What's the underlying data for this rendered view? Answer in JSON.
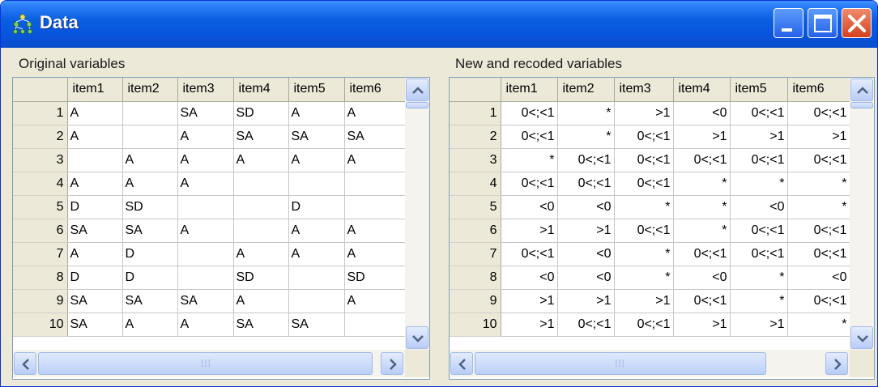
{
  "window": {
    "title": "Data",
    "buttons": [
      "minimize",
      "maximize",
      "close"
    ]
  },
  "left": {
    "label": "Original variables",
    "columns": [
      "item1",
      "item2",
      "item3",
      "item4",
      "item5",
      "item6"
    ],
    "rows": [
      {
        "n": "1",
        "cells": [
          "A",
          "",
          "SA",
          "SD",
          "A",
          "A"
        ]
      },
      {
        "n": "2",
        "cells": [
          "A",
          "",
          "A",
          "SA",
          "SA",
          "SA"
        ]
      },
      {
        "n": "3",
        "cells": [
          "",
          "A",
          "A",
          "A",
          "A",
          "A"
        ]
      },
      {
        "n": "4",
        "cells": [
          "A",
          "A",
          "A",
          "",
          "",
          ""
        ]
      },
      {
        "n": "5",
        "cells": [
          "D",
          "SD",
          "",
          "",
          "D",
          ""
        ]
      },
      {
        "n": "6",
        "cells": [
          "SA",
          "SA",
          "A",
          "",
          "A",
          "A"
        ]
      },
      {
        "n": "7",
        "cells": [
          "A",
          "D",
          "",
          "A",
          "A",
          "A"
        ]
      },
      {
        "n": "8",
        "cells": [
          "D",
          "D",
          "",
          "SD",
          "",
          "SD"
        ]
      },
      {
        "n": "9",
        "cells": [
          "SA",
          "SA",
          "SA",
          "A",
          "",
          "A"
        ]
      },
      {
        "n": "10",
        "cells": [
          "SA",
          "A",
          "A",
          "SA",
          "SA",
          ""
        ]
      }
    ]
  },
  "right": {
    "label": "New and recoded variables",
    "columns": [
      "item1",
      "item2",
      "item3",
      "item4",
      "item5",
      "item6"
    ],
    "rows": [
      {
        "n": "1",
        "cells": [
          "0<;<1",
          "*",
          ">1",
          "<0",
          "0<;<1",
          "0<;<1"
        ]
      },
      {
        "n": "2",
        "cells": [
          "0<;<1",
          "*",
          "0<;<1",
          ">1",
          ">1",
          ">1"
        ]
      },
      {
        "n": "3",
        "cells": [
          "*",
          "0<;<1",
          "0<;<1",
          "0<;<1",
          "0<;<1",
          "0<;<1"
        ]
      },
      {
        "n": "4",
        "cells": [
          "0<;<1",
          "0<;<1",
          "0<;<1",
          "*",
          "*",
          "*"
        ]
      },
      {
        "n": "5",
        "cells": [
          "<0",
          "<0",
          "*",
          "*",
          "<0",
          "*"
        ]
      },
      {
        "n": "6",
        "cells": [
          ">1",
          ">1",
          "0<;<1",
          "*",
          "0<;<1",
          "0<;<1"
        ]
      },
      {
        "n": "7",
        "cells": [
          "0<;<1",
          "<0",
          "*",
          "0<;<1",
          "0<;<1",
          "0<;<1"
        ]
      },
      {
        "n": "8",
        "cells": [
          "<0",
          "<0",
          "*",
          "<0",
          "*",
          "<0"
        ]
      },
      {
        "n": "9",
        "cells": [
          ">1",
          ">1",
          ">1",
          "0<;<1",
          "*",
          "0<;<1"
        ]
      },
      {
        "n": "10",
        "cells": [
          ">1",
          "0<;<1",
          "0<;<1",
          ">1",
          ">1",
          "*"
        ]
      }
    ]
  },
  "icons": {
    "app": "network-tree-icon",
    "scroll_up": "arrow-up-icon",
    "scroll_down": "arrow-down-icon",
    "scroll_left": "arrow-left-icon",
    "scroll_right": "arrow-right-icon"
  },
  "colors": {
    "titlebar": "#0a5fe0",
    "window_bg": "#ece9d8",
    "grid_border": "#7f9db9",
    "close_button": "#d5411e"
  }
}
